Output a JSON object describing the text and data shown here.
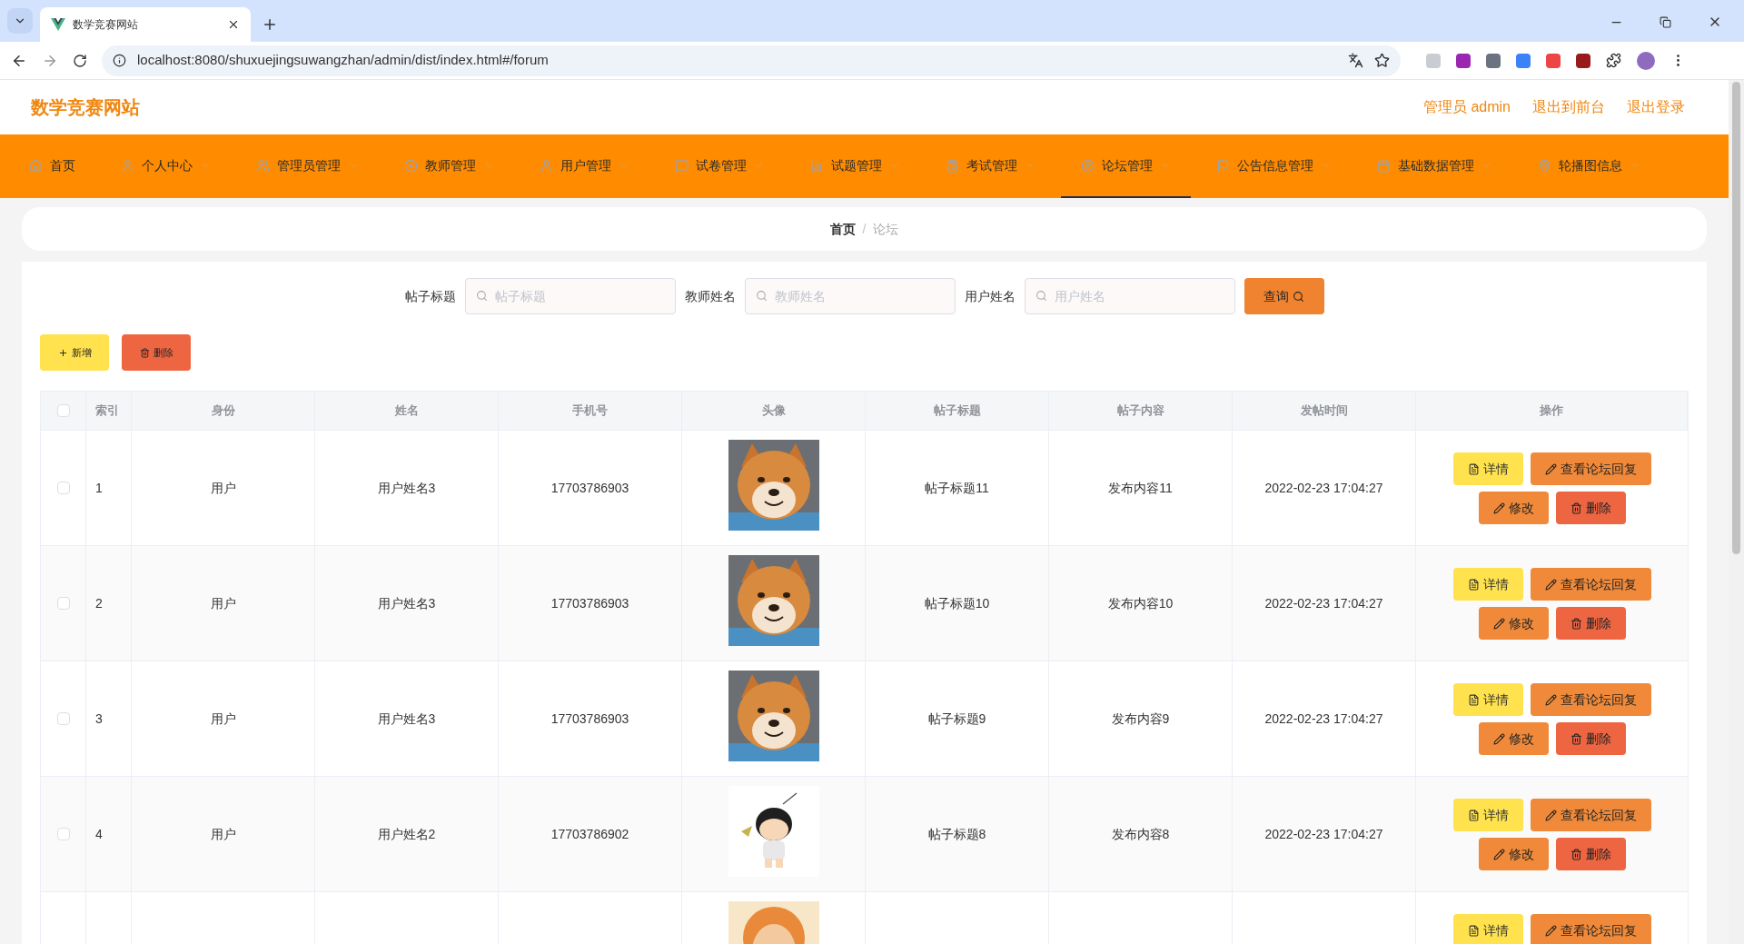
{
  "browser": {
    "tab_title": "数学竞赛网站",
    "url": "localhost:8080/shuxuejingsuwangzhan/admin/dist/index.html#/forum"
  },
  "header": {
    "title": "数学竞赛网站",
    "links": [
      "管理员 admin",
      "退出到前台",
      "退出登录"
    ]
  },
  "nav": [
    {
      "label": "首页",
      "selected": false,
      "has_menu": false
    },
    {
      "label": "个人中心",
      "selected": false,
      "has_menu": true
    },
    {
      "label": "管理员管理",
      "selected": false,
      "has_menu": true
    },
    {
      "label": "教师管理",
      "selected": false,
      "has_menu": true
    },
    {
      "label": "用户管理",
      "selected": false,
      "has_menu": true
    },
    {
      "label": "试卷管理",
      "selected": false,
      "has_menu": true
    },
    {
      "label": "试题管理",
      "selected": false,
      "has_menu": true
    },
    {
      "label": "考试管理",
      "selected": false,
      "has_menu": true
    },
    {
      "label": "论坛管理",
      "selected": true,
      "has_menu": true
    },
    {
      "label": "公告信息管理",
      "selected": false,
      "has_menu": true
    },
    {
      "label": "基础数据管理",
      "selected": false,
      "has_menu": true
    },
    {
      "label": "轮播图信息",
      "selected": false,
      "has_menu": true
    }
  ],
  "breadcrumb": {
    "items": [
      "首页",
      "论坛"
    ],
    "separator": "/"
  },
  "search": {
    "fields": [
      {
        "label": "帖子标题",
        "placeholder": "帖子标题"
      },
      {
        "label": "教师姓名",
        "placeholder": "教师姓名"
      },
      {
        "label": "用户姓名",
        "placeholder": "用户姓名"
      }
    ],
    "button": "查询"
  },
  "toolbar": [
    {
      "kind": "add",
      "label": "新增"
    },
    {
      "kind": "delete",
      "label": "删除"
    }
  ],
  "table": {
    "select_all": {
      "checked": false
    },
    "columns": [
      "索引",
      "身份",
      "姓名",
      "手机号",
      "头像",
      "帖子标题",
      "帖子内容",
      "发帖时间",
      "操作"
    ],
    "rows": [
      {
        "selected": false,
        "index": "1",
        "role": "用户",
        "name": "用户姓名3",
        "phone": "17703786903",
        "avatar": {
          "kind": "picture"
        },
        "title": "帖子标题11",
        "content": "发布内容11",
        "time": "2022-02-23 17:04:27",
        "actions": [
          {
            "kind": "detail",
            "label": "详情"
          },
          {
            "kind": "replies",
            "label": "查看论坛回复"
          },
          {
            "kind": "edit",
            "label": "修改"
          },
          {
            "kind": "delete",
            "label": "删除"
          }
        ]
      },
      {
        "selected": false,
        "index": "2",
        "role": "用户",
        "name": "用户姓名3",
        "phone": "17703786903",
        "avatar": {
          "kind": "picture"
        },
        "title": "帖子标题10",
        "content": "发布内容10",
        "time": "2022-02-23 17:04:27",
        "actions": [
          {
            "kind": "detail",
            "label": "详情"
          },
          {
            "kind": "replies",
            "label": "查看论坛回复"
          },
          {
            "kind": "edit",
            "label": "修改"
          },
          {
            "kind": "delete",
            "label": "删除"
          }
        ]
      },
      {
        "selected": false,
        "index": "3",
        "role": "用户",
        "name": "用户姓名3",
        "phone": "17703786903",
        "avatar": {
          "kind": "picture"
        },
        "title": "帖子标题9",
        "content": "发布内容9",
        "time": "2022-02-23 17:04:27",
        "actions": [
          {
            "kind": "detail",
            "label": "详情"
          },
          {
            "kind": "replies",
            "label": "查看论坛回复"
          },
          {
            "kind": "edit",
            "label": "修改"
          },
          {
            "kind": "delete",
            "label": "删除"
          }
        ]
      },
      {
        "selected": false,
        "index": "4",
        "role": "用户",
        "name": "用户姓名2",
        "phone": "17703786902",
        "avatar": {
          "kind": "picture"
        },
        "title": "帖子标题8",
        "content": "发布内容8",
        "time": "2022-02-23 17:04:27",
        "actions": [
          {
            "kind": "detail",
            "label": "详情"
          },
          {
            "kind": "replies",
            "label": "查看论坛回复"
          },
          {
            "kind": "edit",
            "label": "修改"
          },
          {
            "kind": "delete",
            "label": "删除"
          }
        ]
      },
      {
        "avatar": {
          "kind": "picture"
        },
        "actions": [
          {
            "kind": "detail",
            "label": "详情"
          },
          {
            "kind": "replies",
            "label": "查看论坛回复"
          }
        ]
      }
    ]
  }
}
